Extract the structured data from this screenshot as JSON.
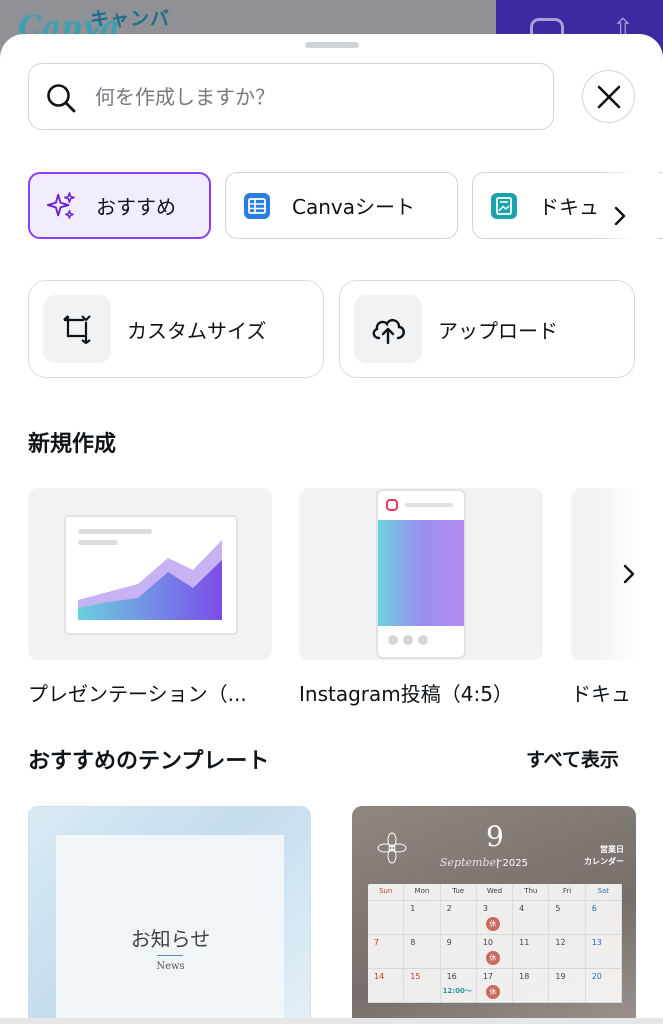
{
  "background": {
    "logo_text": "キャンバ"
  },
  "search": {
    "placeholder": "何を作成しますか？"
  },
  "chips": [
    {
      "label": "おすすめ",
      "icon": "sparkles-icon"
    },
    {
      "label": "Canvaシート",
      "icon": "sheets-icon"
    },
    {
      "label": "ドキュ",
      "icon": "docs-icon"
    }
  ],
  "actions": [
    {
      "label": "カスタムサイズ",
      "icon": "resize-icon"
    },
    {
      "label": "アップロード",
      "icon": "cloud-upload-icon"
    }
  ],
  "new_section": {
    "title": "新規作成",
    "items": [
      {
        "label": "プレゼンテーション（..."
      },
      {
        "label": "Instagram投稿（4:5）"
      },
      {
        "label": "ドキュ"
      }
    ]
  },
  "templates": {
    "title": "おすすめのテンプレート",
    "see_all": "すべて表示",
    "items": [
      {
        "title": "お知らせ",
        "subtitle": "News"
      },
      {
        "month": "9",
        "script": "September",
        "year": "| 2025",
        "caption_line1": "営業日",
        "caption_line2": "カレンダー",
        "weekdays": [
          "Sun",
          "Mon",
          "Tue",
          "Wed",
          "Thu",
          "Fri",
          "Sat"
        ],
        "rows": [
          [
            "",
            "1",
            "2",
            "3",
            "4",
            "5",
            "6"
          ],
          [
            "7",
            "8",
            "9",
            "10",
            "11",
            "12",
            "13"
          ],
          [
            "14",
            "15",
            "16",
            "17",
            "18",
            "19",
            "20"
          ]
        ],
        "holiday_mark": "休",
        "time_note": "12:00〜"
      }
    ]
  },
  "colors": {
    "accent": "#8b3dff",
    "chip_active_bg": "#f2ecff",
    "sheets_blue": "#2a7de1",
    "docs_teal": "#1aa3a8"
  }
}
